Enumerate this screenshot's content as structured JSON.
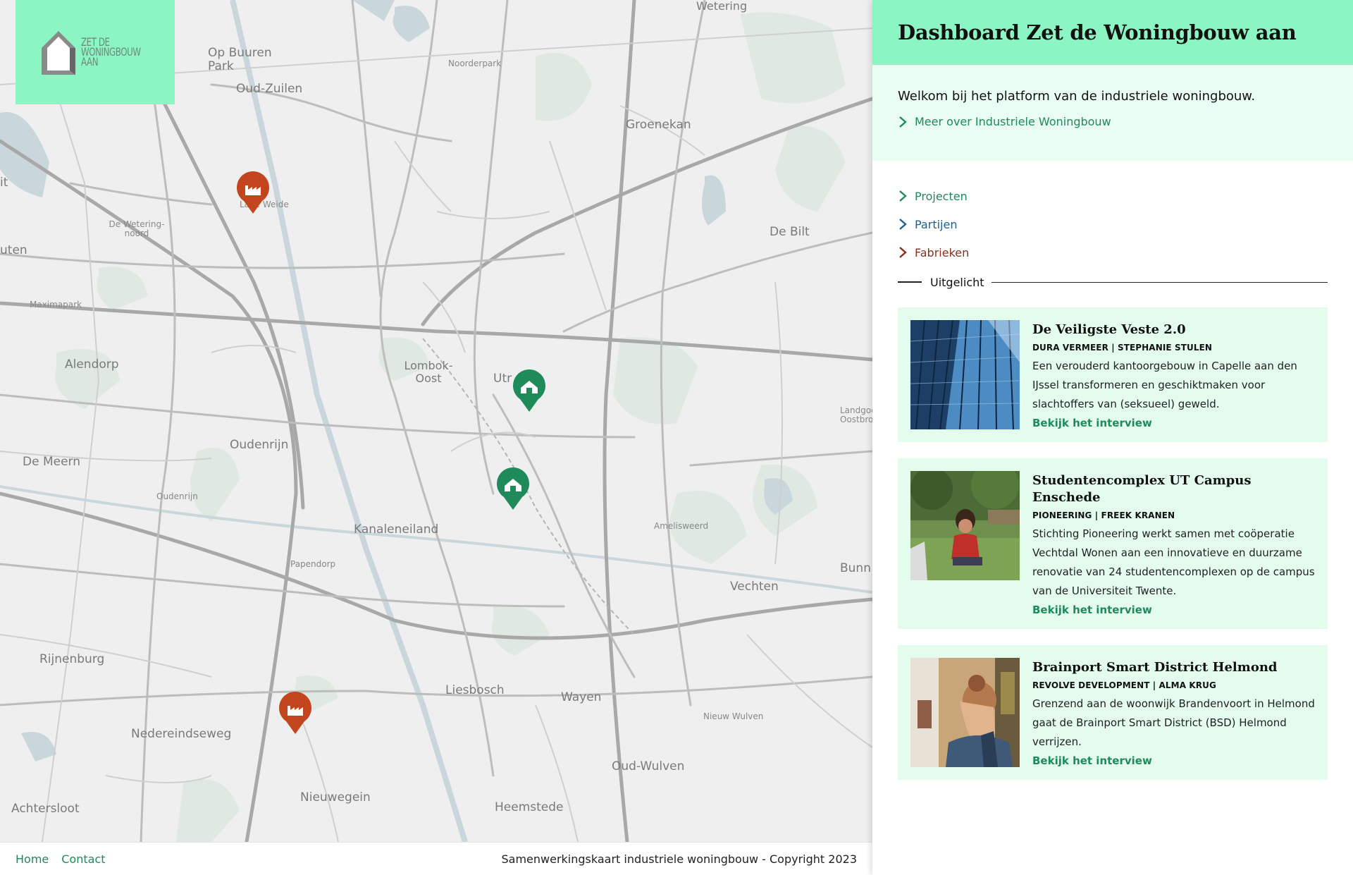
{
  "map": {
    "places": [
      {
        "name": "Wetering"
      },
      {
        "name": "Op Buuren Park"
      },
      {
        "name": "Oud-Zuilen"
      },
      {
        "name": "Noorderpark"
      },
      {
        "name": "Groenekan"
      },
      {
        "name": "De Bilt"
      },
      {
        "name": "Lage Weide"
      },
      {
        "name": "De Wetering-noord"
      },
      {
        "name": "Maximapark"
      },
      {
        "name": "Alendorp"
      },
      {
        "name": "Lombok-Oost"
      },
      {
        "name": "Utr"
      },
      {
        "name": "Oudenrijn"
      },
      {
        "name": "De Meern"
      },
      {
        "name": "Oudenrijn"
      },
      {
        "name": "Kanaleneiland"
      },
      {
        "name": "Amelisweerd"
      },
      {
        "name": "Papendorp"
      },
      {
        "name": "Vechten"
      },
      {
        "name": "Bunn"
      },
      {
        "name": "Rijnenburg"
      },
      {
        "name": "Liesbosch"
      },
      {
        "name": "Wayen"
      },
      {
        "name": "Nieuw Wulven"
      },
      {
        "name": "Nedereindseweg"
      },
      {
        "name": "Oud-Wulven"
      },
      {
        "name": "Nieuwegein"
      },
      {
        "name": "Heemstede"
      },
      {
        "name": "Achtersloot"
      },
      {
        "name": "Landgoed Oostbroek"
      },
      {
        "name": "uten"
      },
      {
        "name": "it"
      }
    ],
    "markers": [
      {
        "type": "factory",
        "icon": "factory-icon",
        "color": "#c2451e"
      },
      {
        "type": "project",
        "icon": "house-icon",
        "color": "#1f8a5a"
      },
      {
        "type": "project",
        "icon": "house-icon",
        "color": "#1f8a5a"
      },
      {
        "type": "factory",
        "icon": "factory-icon",
        "color": "#c2451e"
      }
    ]
  },
  "logo": {
    "text_line1": "ZET DE",
    "text_line2": "WONINGBOUW",
    "text_line3": "AAN"
  },
  "footer": {
    "home": "Home",
    "contact": "Contact",
    "copyright": "Samenwerkingskaart industriele woningbouw - Copyright 2023"
  },
  "panel": {
    "title": "Dashboard Zet de Woningbouw aan",
    "welcome": "Welkom bij het platform van de industriele woningbouw.",
    "more_link": "Meer over Industriele Woningbouw",
    "nav": [
      {
        "label": "Projecten",
        "color": "#1f8a5a"
      },
      {
        "label": "Partijen",
        "color": "#1f5f8a"
      },
      {
        "label": "Fabrieken",
        "color": "#8a2f1a"
      }
    ],
    "featured_title": "Uitgelicht",
    "cards": [
      {
        "title": "De Veiligste Veste 2.0",
        "authors": "DURA VERMEER | STEPHANIE STULEN",
        "desc": "Een verouderd kantoorgebouw in Capelle aan den IJssel transformeren en geschiktmaken voor slachtoffers van (seksueel) geweld.",
        "cta": "Bekijk het interview"
      },
      {
        "title": "Studentencomplex UT Campus Enschede",
        "authors": "PIONEERING | FREEK KRANEN",
        "desc": "Stichting Pioneering werkt samen met coöperatie Vechtdal Wonen aan een innovatieve en duurzame renovatie van 24 studentencomplexen op de campus van de Universiteit Twente.",
        "cta": "Bekijk het interview"
      },
      {
        "title": "Brainport Smart District Helmond",
        "authors": "REVOLVE DEVELOPMENT | ALMA KRUG",
        "desc": "Grenzend aan de woonwijk Brandenvoort in Helmond gaat de Brainport Smart District (BSD) Helmond verrijzen.",
        "cta": "Bekijk het interview"
      }
    ],
    "accent": "#8cf5c4"
  }
}
